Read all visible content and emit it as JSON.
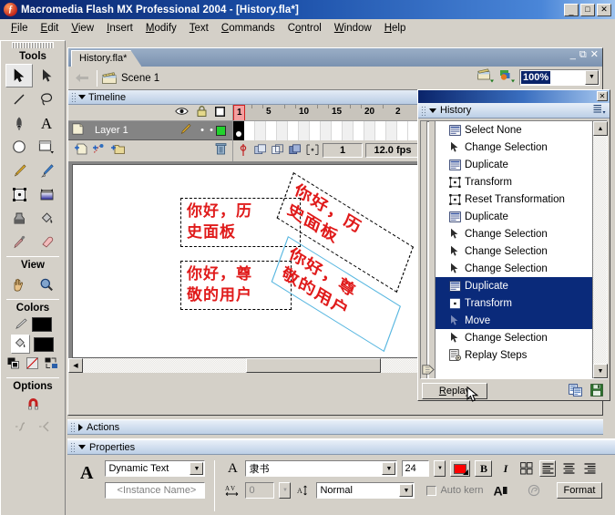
{
  "window": {
    "title": "Macromedia Flash MX Professional 2004 - [History.fla*]",
    "logo_glyph": "ƒ",
    "minimize": "–",
    "maximize": "❐",
    "close": "✕"
  },
  "menubar": {
    "items": [
      {
        "label": "File",
        "accel": "F"
      },
      {
        "label": "Edit",
        "accel": "E"
      },
      {
        "label": "View",
        "accel": "V"
      },
      {
        "label": "Insert",
        "accel": "I"
      },
      {
        "label": "Modify",
        "accel": "M"
      },
      {
        "label": "Text",
        "accel": "T"
      },
      {
        "label": "Commands",
        "accel": "C"
      },
      {
        "label": "Control",
        "accel": "o"
      },
      {
        "label": "Window",
        "accel": "W"
      },
      {
        "label": "Help",
        "accel": "H"
      }
    ]
  },
  "tools": {
    "section_tools": "Tools",
    "section_view": "View",
    "section_colors": "Colors",
    "section_options": "Options",
    "items": [
      {
        "name": "selection-tool",
        "selected": true
      },
      {
        "name": "subselection-tool",
        "selected": false
      },
      {
        "name": "line-tool",
        "selected": false
      },
      {
        "name": "lasso-tool",
        "selected": false
      },
      {
        "name": "pen-tool",
        "selected": false
      },
      {
        "name": "text-tool",
        "selected": false
      },
      {
        "name": "oval-tool",
        "selected": false
      },
      {
        "name": "rectangle-tool",
        "selected": false
      },
      {
        "name": "pencil-tool",
        "selected": false
      },
      {
        "name": "brush-tool",
        "selected": false
      },
      {
        "name": "free-transform-tool",
        "selected": false
      },
      {
        "name": "fill-transform-tool",
        "selected": false
      },
      {
        "name": "ink-bottle-tool",
        "selected": false
      },
      {
        "name": "paint-bucket-tool",
        "selected": false
      },
      {
        "name": "eyedropper-tool",
        "selected": false
      },
      {
        "name": "eraser-tool",
        "selected": false
      }
    ],
    "view_items": [
      {
        "name": "hand-tool"
      },
      {
        "name": "zoom-tool"
      }
    ],
    "colors": {
      "stroke_color": "#000000",
      "fill_color": "#000000",
      "modifiers": [
        "black-and-white-icon",
        "no-color-icon",
        "swap-colors-icon"
      ]
    },
    "options": {
      "magnet_name": "snap-to-objects-icon",
      "smooth_name": "smooth-icon",
      "straighten_name": "straighten-icon"
    }
  },
  "document": {
    "tab_label": "History.fla*",
    "minimize": "–",
    "restore": "❐",
    "close": "✕",
    "scene_label": "Scene 1",
    "zoom_value": "100%",
    "edit_scene_icon": "edit-scene-icon",
    "edit_symbols_icon": "edit-symbols-icon"
  },
  "timeline": {
    "title": "Timeline",
    "col_eye": "eye-icon",
    "col_lock": "lock-icon",
    "col_outline": "outline-icon",
    "layers": [
      {
        "name": "Layer 1",
        "visible_dot": "•",
        "lock_dot": "•",
        "outline_color": "#22d22d"
      }
    ],
    "ruler_labels": [
      "1",
      "5",
      "10",
      "15",
      "20",
      "2"
    ],
    "current_frame": "1",
    "fps": "12.0 fps",
    "elapsed": "1",
    "buttons": [
      {
        "name": "insert-layer-button"
      },
      {
        "name": "add-motion-guide-button"
      },
      {
        "name": "insert-layer-folder-button"
      },
      {
        "name": "delete-layer-button"
      }
    ],
    "status_buttons": [
      {
        "name": "center-frame-button"
      },
      {
        "name": "onion-skin-button"
      },
      {
        "name": "onion-skin-outlines-button"
      },
      {
        "name": "edit-multiple-frames-button"
      },
      {
        "name": "modify-onion-markers-button"
      }
    ]
  },
  "stage": {
    "textboxes": [
      {
        "name": "text-field-1",
        "lines": [
          "你好，历",
          "史面板"
        ],
        "color": "#e01b1b"
      },
      {
        "name": "text-field-2",
        "lines": [
          "你好，尊",
          "敬的用户"
        ],
        "color": "#e01b1b"
      },
      {
        "name": "text-field-3-transformed",
        "lines": [
          "你好，历",
          "史面板"
        ],
        "color": "#e01b1b"
      },
      {
        "name": "text-field-4-transformed",
        "lines": [
          "你好，尊",
          "敬的用户"
        ],
        "color": "#e01b1b"
      }
    ]
  },
  "history": {
    "title": "History",
    "close_glyph": "✕",
    "menu_icon": "panel-options-icon",
    "items": [
      {
        "label": "Select None",
        "icon": "text-lines-icon",
        "selected": false
      },
      {
        "label": "Change Selection",
        "icon": "arrow-cursor-icon",
        "selected": false
      },
      {
        "label": "Duplicate",
        "icon": "text-lines-icon",
        "selected": false
      },
      {
        "label": "Transform",
        "icon": "transform-icon",
        "selected": false
      },
      {
        "label": "Reset Transformation",
        "icon": "transform-icon",
        "selected": false
      },
      {
        "label": "Duplicate",
        "icon": "text-lines-icon",
        "selected": false
      },
      {
        "label": "Change Selection",
        "icon": "arrow-cursor-icon",
        "selected": false
      },
      {
        "label": "Change Selection",
        "icon": "arrow-cursor-icon",
        "selected": false
      },
      {
        "label": "Change Selection",
        "icon": "arrow-cursor-icon",
        "selected": false
      },
      {
        "label": "Duplicate",
        "icon": "text-lines-icon",
        "selected": true
      },
      {
        "label": "Transform",
        "icon": "transform-icon",
        "selected": true
      },
      {
        "label": "Move",
        "icon": "arrow-cursor-icon",
        "selected": true
      },
      {
        "label": "Change Selection",
        "icon": "arrow-cursor-icon",
        "selected": false
      },
      {
        "label": "Replay Steps",
        "icon": "replay-steps-icon",
        "selected": false
      }
    ],
    "replay_button": "Replay",
    "copy_icon": "copy-steps-icon",
    "save_icon": "save-as-command-icon"
  },
  "actions": {
    "title": "Actions"
  },
  "properties": {
    "title": "Properties",
    "type_label": "A",
    "text_type": "Dynamic Text",
    "instance_name_placeholder": "<Instance Name>",
    "font_family": "隶书",
    "font_size": "24",
    "text_color": "#ff0000",
    "bold_label": "B",
    "italic_label": "I",
    "letter_spacing": "0",
    "baseline_shift": "Normal",
    "auto_kern_label": "Auto kern",
    "format_button": "Format",
    "icons": {
      "font_icon": "font-A-icon",
      "char_spacing_icon": "character-spacing-icon",
      "baseline_icon": "baseline-shift-icon",
      "url_icon": "url-link-icon",
      "align_left": "align-left-icon",
      "align_center": "align-center-icon",
      "align_right": "align-right-icon",
      "selectable_icon": "selectable-text-icon",
      "render_icon": "render-text-as-html-icon"
    }
  }
}
